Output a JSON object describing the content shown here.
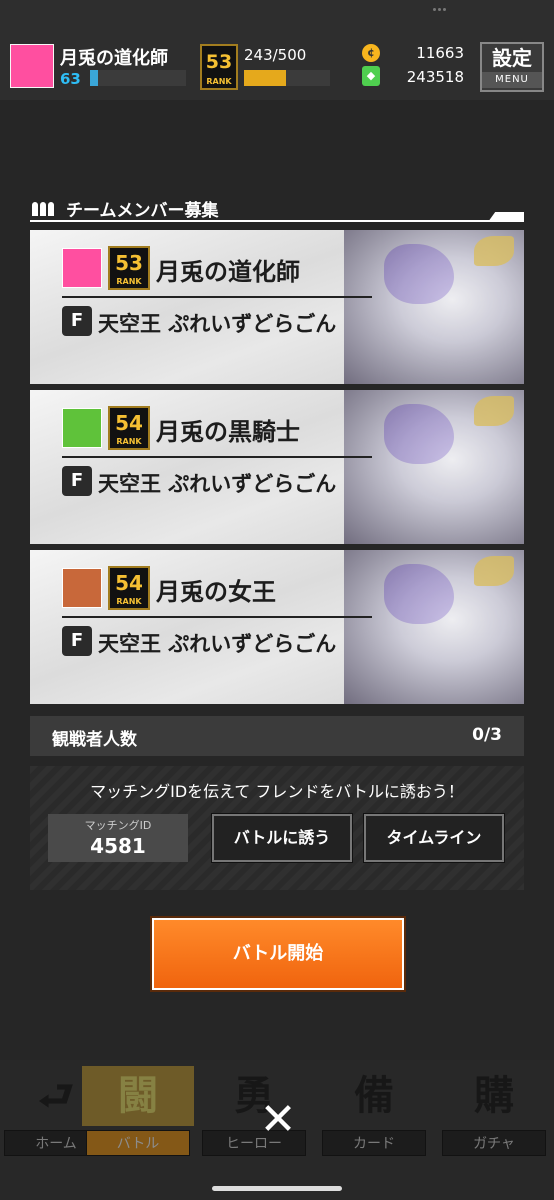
{
  "status": {
    "player_name": "月兎の道化師",
    "player_level": "63",
    "level_progress": 0.08,
    "rank_value": "53",
    "rank_label": "RANK",
    "rank_points": "243/500",
    "rank_progress": 0.49,
    "coins": "11663",
    "gems": "243518",
    "settings_label": "設定",
    "settings_sub": "MENU"
  },
  "section": {
    "title": "チームメンバー募集"
  },
  "members": [
    {
      "name": "月兎の道化師",
      "rank": "53",
      "rank_label": "RANK",
      "title": "天空王 ぷれいずどらごん",
      "avatar_color": "#ff4fa0"
    },
    {
      "name": "月兎の黒騎士",
      "rank": "54",
      "rank_label": "RANK",
      "title": "天空王 ぷれいずどらごん",
      "avatar_color": "#5fc23a"
    },
    {
      "name": "月兎の女王",
      "rank": "54",
      "rank_label": "RANK",
      "title": "天空王 ぷれいずどらごん",
      "avatar_color": "#c8683a"
    }
  ],
  "spectators": {
    "label": "観戦者人数",
    "value": "0/3"
  },
  "matching": {
    "message": "マッチングIDを伝えて フレンドをバトルに誘おう！",
    "id_caption": "マッチングID",
    "id_value": "4581",
    "invite_label": "バトルに誘う",
    "timeline_label": "タイムライン"
  },
  "battle_start_label": "バトル開始",
  "nav": [
    {
      "label": "ホーム",
      "icon": "home-icon",
      "glyph": "⮐"
    },
    {
      "label": "バトル",
      "icon": "battle-icon",
      "glyph": "闘"
    },
    {
      "label": "ヒーロー",
      "icon": "hero-icon",
      "glyph": "勇"
    },
    {
      "label": "カード",
      "icon": "card-icon",
      "glyph": "備"
    },
    {
      "label": "ガチャ",
      "icon": "gacha-icon",
      "glyph": "購"
    }
  ],
  "close_glyph": "✕"
}
